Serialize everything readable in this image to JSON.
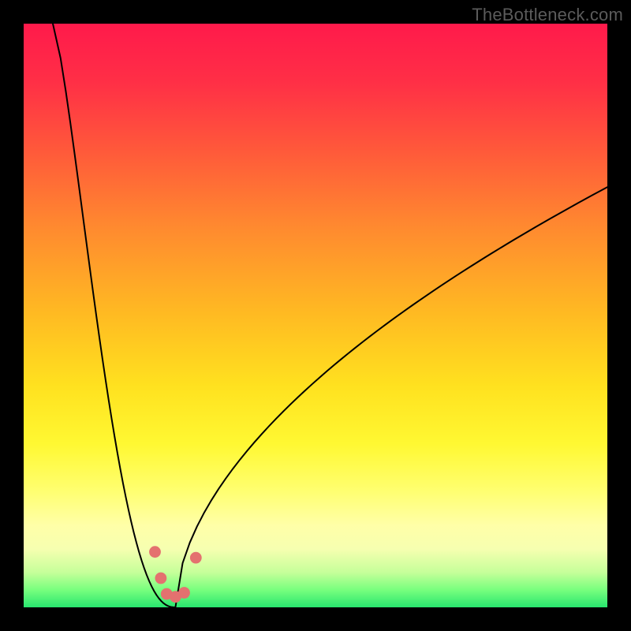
{
  "watermark": "TheBottleneck.com",
  "gradient": {
    "stops": [
      {
        "offset": 0.0,
        "color": "#ff1a4b"
      },
      {
        "offset": 0.1,
        "color": "#ff2f46"
      },
      {
        "offset": 0.22,
        "color": "#ff5a3a"
      },
      {
        "offset": 0.35,
        "color": "#ff8a2f"
      },
      {
        "offset": 0.5,
        "color": "#ffbb22"
      },
      {
        "offset": 0.62,
        "color": "#ffe11f"
      },
      {
        "offset": 0.72,
        "color": "#fff832"
      },
      {
        "offset": 0.8,
        "color": "#ffff70"
      },
      {
        "offset": 0.86,
        "color": "#ffffa8"
      },
      {
        "offset": 0.9,
        "color": "#f6ffb0"
      },
      {
        "offset": 0.94,
        "color": "#c6ff9a"
      },
      {
        "offset": 0.97,
        "color": "#78ff7e"
      },
      {
        "offset": 1.0,
        "color": "#28e66f"
      }
    ]
  },
  "chart_data": {
    "type": "line",
    "title": "",
    "xlabel": "",
    "ylabel": "",
    "xlim": [
      0,
      100
    ],
    "ylim": [
      0,
      100
    ],
    "curve": {
      "min_x": 26,
      "segments": [
        {
          "x0": 5,
          "y0": 100,
          "x1": 26,
          "y1": 0,
          "shape": "concave-left"
        },
        {
          "x0": 26,
          "y0": 0,
          "x1": 100,
          "y1": 72,
          "shape": "concave-right"
        }
      ]
    },
    "markers": [
      {
        "x": 22.5,
        "y": 9.5
      },
      {
        "x": 23.5,
        "y": 5.0
      },
      {
        "x": 24.5,
        "y": 2.3
      },
      {
        "x": 26.0,
        "y": 1.8
      },
      {
        "x": 27.5,
        "y": 2.5
      },
      {
        "x": 29.5,
        "y": 8.5
      }
    ],
    "marker_style": {
      "radius_pct": 1.0,
      "fill": "#e4716f"
    },
    "curve_style": {
      "stroke": "#000000",
      "width": 2
    }
  }
}
